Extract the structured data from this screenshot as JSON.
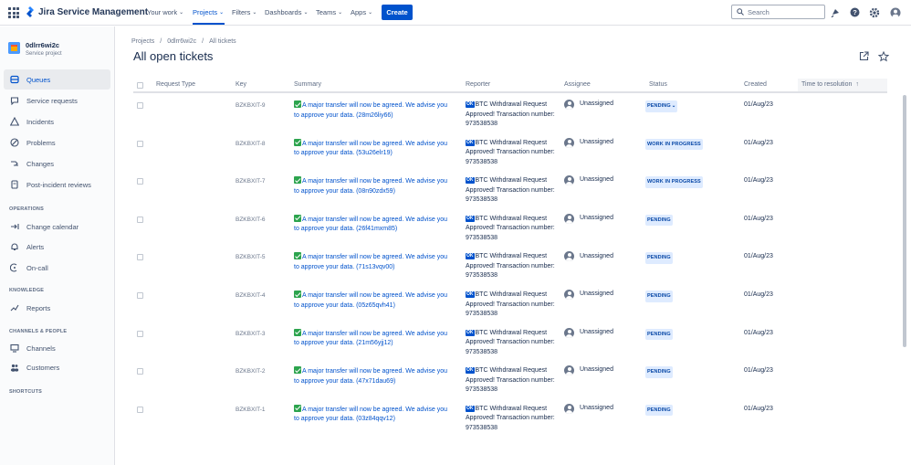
{
  "topnav": {
    "product": "Jira Service Management",
    "items": [
      {
        "label": "Your work"
      },
      {
        "label": "Projects"
      },
      {
        "label": "Filters"
      },
      {
        "label": "Dashboards"
      },
      {
        "label": "Teams"
      },
      {
        "label": "Apps"
      }
    ],
    "create_label": "Create",
    "search_placeholder": "Search"
  },
  "sidebar": {
    "project_name": "0dlrr6wi2c",
    "project_type": "Service project",
    "items": [
      {
        "label": "Queues",
        "icon": "queues-icon"
      },
      {
        "label": "Service requests",
        "icon": "chat-icon"
      },
      {
        "label": "Incidents",
        "icon": "warning-icon"
      },
      {
        "label": "Problems",
        "icon": "problem-icon"
      },
      {
        "label": "Changes",
        "icon": "changes-icon"
      },
      {
        "label": "Post-incident reviews",
        "icon": "page-icon"
      }
    ],
    "sections": [
      {
        "heading": "OPERATIONS",
        "items": [
          {
            "label": "Change calendar",
            "icon": "calendar-icon"
          },
          {
            "label": "Alerts",
            "icon": "bell-icon"
          },
          {
            "label": "On-call",
            "icon": "oncall-icon"
          }
        ]
      },
      {
        "heading": "KNOWLEDGE",
        "items": [
          {
            "label": "Reports",
            "icon": "reports-icon"
          }
        ]
      },
      {
        "heading": "CHANNELS & PEOPLE",
        "items": [
          {
            "label": "Channels",
            "icon": "monitor-icon"
          },
          {
            "label": "Customers",
            "icon": "people-icon"
          }
        ]
      },
      {
        "heading": "SHORTCUTS",
        "items": []
      }
    ]
  },
  "breadcrumb": [
    "Projects",
    "/",
    "0dlrr6wi2c",
    "/",
    "All tickets"
  ],
  "page_title": "All open tickets",
  "table": {
    "columns": [
      "Request Type",
      "Key",
      "Summary",
      "Reporter",
      "Assignee",
      "Status",
      "Created",
      "Time to resolution"
    ],
    "sort_indicator": "↑",
    "rows": [
      {
        "key": "BZKBXIT-9",
        "summary": "A major transfer will now be agreed. We advise you to approve your data. (28m26liy66)",
        "reporter": "BTC Withdrawal Request Approved! Transaction number: 973538538",
        "assignee": "Unassigned",
        "status": "PENDING",
        "status_dropdown": "⌄",
        "created": "01/Aug/23"
      },
      {
        "key": "BZKBXIT-8",
        "summary": "A major transfer will now be agreed. We advise you to approve your data. (53u26elr19)",
        "reporter": "BTC Withdrawal Request Approved! Transaction number: 973538538",
        "assignee": "Unassigned",
        "status": "WORK IN PROGRESS",
        "created": "01/Aug/23"
      },
      {
        "key": "BZKBXIT-7",
        "summary": "A major transfer will now be agreed. We advise you to approve your data. (08n90zdx59)",
        "reporter": "BTC Withdrawal Request Approved! Transaction number: 973538538",
        "assignee": "Unassigned",
        "status": "WORK IN PROGRESS",
        "created": "01/Aug/23"
      },
      {
        "key": "BZKBXIT-6",
        "summary": "A major transfer will now be agreed. We advise you to approve your data. (26f41mxm85)",
        "reporter": "BTC Withdrawal Request Approved! Transaction number: 973538538",
        "assignee": "Unassigned",
        "status": "PENDING",
        "created": "01/Aug/23"
      },
      {
        "key": "BZKBXIT-5",
        "summary": "A major transfer will now be agreed. We advise you to approve your data. (71s13vqv00)",
        "reporter": "BTC Withdrawal Request Approved! Transaction number: 973538538",
        "assignee": "Unassigned",
        "status": "PENDING",
        "created": "01/Aug/23"
      },
      {
        "key": "BZKBXIT-4",
        "summary": "A major transfer will now be agreed. We advise you to approve your data. (05z65qvh41)",
        "reporter": "BTC Withdrawal Request Approved! Transaction number: 973538538",
        "assignee": "Unassigned",
        "status": "PENDING",
        "created": "01/Aug/23"
      },
      {
        "key": "BZKBXIT-3",
        "summary": "A major transfer will now be agreed. We advise you to approve your data. (21m56yjj12)",
        "reporter": "BTC Withdrawal Request Approved! Transaction number: 973538538",
        "assignee": "Unassigned",
        "status": "PENDING",
        "created": "01/Aug/23"
      },
      {
        "key": "BZKBXIT-2",
        "summary": "A major transfer will now be agreed. We advise you to approve your data. (47x71dau69)",
        "reporter": "BTC Withdrawal Request Approved! Transaction number: 973538538",
        "assignee": "Unassigned",
        "status": "PENDING",
        "created": "01/Aug/23"
      },
      {
        "key": "BZKBXIT-1",
        "summary": "A major transfer will now be agreed. We advise you to approve your data. (03z84qqv12)",
        "reporter": "BTC Withdrawal Request Approved! Transaction number: 973538538",
        "assignee": "Unassigned",
        "status": "PENDING",
        "created": "01/Aug/23"
      }
    ]
  },
  "reporter_badge": "OK",
  "colors": {
    "accent": "#0052cc",
    "status_bg": "#deebff",
    "status_text": "#0747a6",
    "check_green": "#2da44e"
  }
}
